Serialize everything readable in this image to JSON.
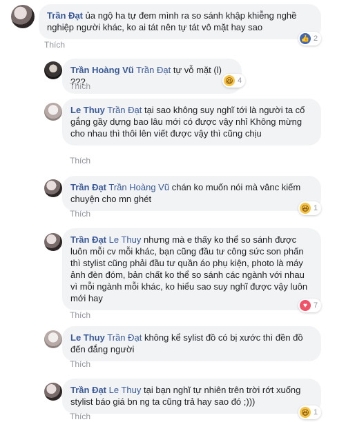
{
  "comments": [
    {
      "author": "Trần Đạt",
      "mention": "",
      "text": "ủa ngộ ha tự đem mình ra so sánh khập khiễng nghề nghiệp người khác, ko ai tát nên tự tát vô mặt hay sao",
      "like_label": "Thích",
      "reaction": {
        "icon": "like-icon",
        "glyph": "👍",
        "count": "2"
      }
    },
    {
      "author": "Trần Hoàng Vũ",
      "mention": "Trần Đạt",
      "text": "tự vỗ mặt (l) ???",
      "like_label": "Thích",
      "reaction": {
        "icon": "haha-icon",
        "glyph": "😆",
        "count": "4"
      }
    },
    {
      "author": "Le Thuy",
      "mention": "Trần Đạt",
      "text": "tại sao không suy nghĩ tới là người ta cố gắng gầy dựng bao lâu mới có được vậy nhỉ Không mừng cho nhau thì thôi lên viết được vậy thì cũng chịu",
      "like_label": "Thích",
      "reaction": null
    },
    {
      "author": "Trần Đạt",
      "mention": "Trần Hoàng Vũ",
      "text": "chán ko muốn nói mà vânc kiếm chuyện cho mn ghét",
      "like_label": "Thích",
      "reaction": {
        "icon": "haha-icon",
        "glyph": "😆",
        "count": "1"
      }
    },
    {
      "author": "Trần Đạt",
      "mention": "Le Thuy",
      "text": "nhưng mà e thấy ko thể so sánh được luôn mỗi cv mỗi khác, bạn cũng đầu tư công sức son phấn thì stylist cũng phải đầu tư quần áo phụ kiện, photo là máy ảnh đèn đóm, bản chất ko thể so sánh các ngành với nhau vì mỗi ngành mỗi khác, ko hiểu sao suy nghĩ được vậy luôn mới hay",
      "like_label": "Thích",
      "reaction": {
        "icon": "love-icon",
        "glyph": "♥",
        "count": "7"
      }
    },
    {
      "author": "Le Thuy",
      "mention": "Trần Đạt",
      "text": "không kể sylist đồ có bị xước thì đền đồ đến đắng người",
      "like_label": "Thích",
      "reaction": null
    },
    {
      "author": "Trần Đạt",
      "mention": "Le Thuy",
      "text": "tại bạn nghĩ tự nhiên trên trời rớt xuống stylist báo giá bn ng ta cũng trả hay sao đó ;)))",
      "like_label": "Thích",
      "reaction": {
        "icon": "haha-icon",
        "glyph": "😆",
        "count": "1"
      }
    }
  ]
}
